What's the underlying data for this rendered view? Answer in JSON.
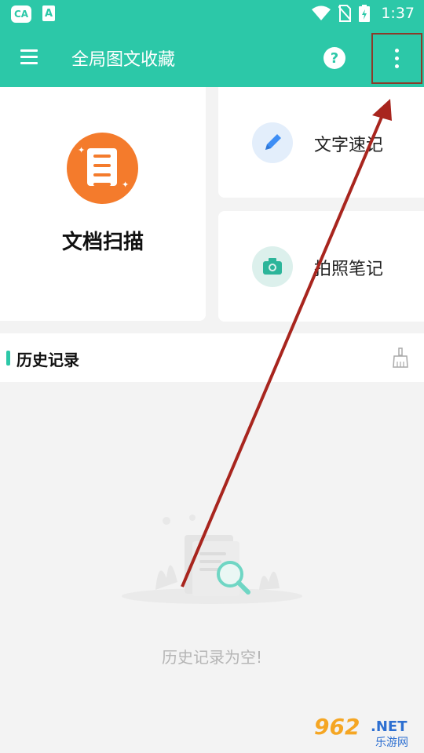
{
  "status_bar": {
    "app_icon_label": "CA",
    "a_icon_label": "A",
    "time": "1:37",
    "icons": [
      "wifi-icon",
      "no-sim-icon",
      "battery-icon"
    ]
  },
  "app_bar": {
    "title": "全局图文收藏",
    "help_label": "?",
    "icons": [
      "menu-icon",
      "help-icon",
      "more-vert-icon"
    ],
    "accent": "#2cc8a8"
  },
  "cards": {
    "scan": {
      "label": "文档扫描",
      "icon": "document-icon",
      "color": "#f47b2c"
    },
    "quick_text": {
      "label": "文字速记",
      "icon": "pencil-icon",
      "color": "#3e8ef5"
    },
    "photo_note": {
      "label": "拍照笔记",
      "icon": "camera-icon",
      "color": "#2cb59a"
    }
  },
  "history": {
    "label": "历史记录",
    "clear_icon": "broom-icon",
    "empty_text": "历史记录为空!"
  },
  "watermark": {
    "number": "962",
    "suffix": ".NET",
    "cn": "乐游网"
  },
  "annotation": {
    "type": "arrow",
    "color": "#a8251e"
  }
}
